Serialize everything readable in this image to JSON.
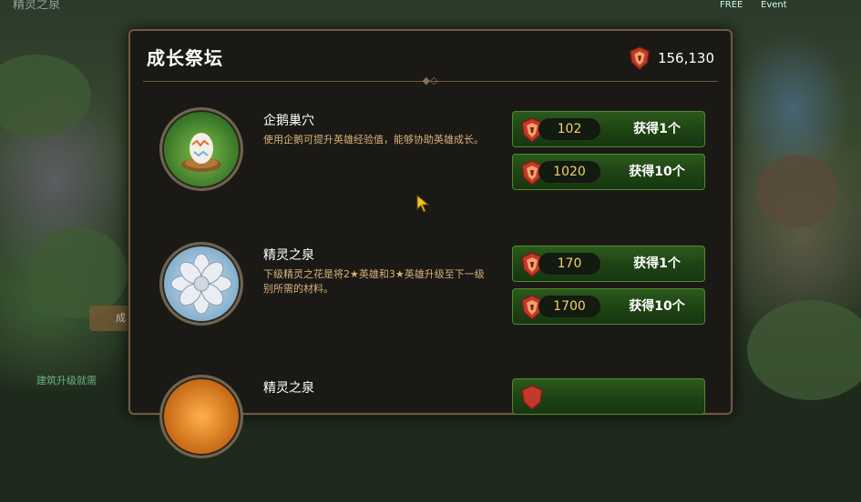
{
  "background": {
    "top_left_text": "精灵之泉",
    "bottom_left_text": "建筑升级就需",
    "side_button_label": "成",
    "top_icon_labels": [
      "FREE",
      "Event"
    ]
  },
  "panel": {
    "title": "成长祭坛",
    "currency_amount": "156,130",
    "currency_icon": "red-crest-emblem-icon"
  },
  "items": [
    {
      "name": "企鹅巢穴",
      "description": "使用企鹅可提升英雄经验值，能够协助英雄成长。",
      "icon": "egg-nest-icon",
      "buttons": [
        {
          "price": "102",
          "label": "获得1个"
        },
        {
          "price": "1020",
          "label": "获得10个"
        }
      ]
    },
    {
      "name": "精灵之泉",
      "description": "下级精灵之花是将2★英雄和3★英雄升级至下一级别所需的材料。",
      "icon": "silver-flower-icon",
      "buttons": [
        {
          "price": "170",
          "label": "获得1个"
        },
        {
          "price": "1700",
          "label": "获得10个"
        }
      ]
    },
    {
      "name": "精灵之泉",
      "description": "",
      "icon": "orange-orb-icon",
      "buttons": [
        {
          "price": "",
          "label": ""
        }
      ]
    }
  ],
  "colors": {
    "button_green": "#1f4414",
    "price_gold": "#f0d36a",
    "desc_orange": "#d7b27a",
    "border_bronze": "#6d5b40"
  }
}
